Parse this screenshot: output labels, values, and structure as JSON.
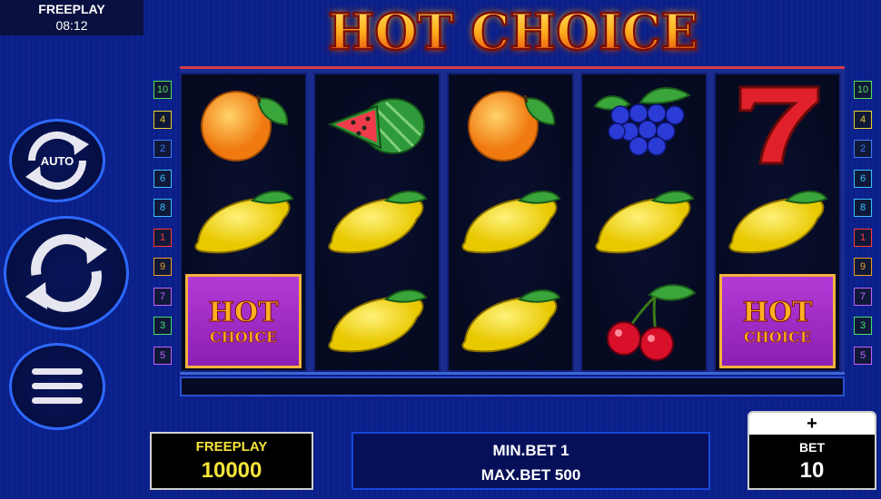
{
  "status": {
    "mode": "FREEPLAY",
    "time": "08:12"
  },
  "logo": {
    "text": "HOT CHOICE"
  },
  "left_lines": [
    "10",
    "4",
    "2",
    "6",
    "8",
    "1",
    "9",
    "7",
    "3",
    "5"
  ],
  "right_lines": [
    "10",
    "4",
    "2",
    "6",
    "8",
    "1",
    "9",
    "7",
    "3",
    "5"
  ],
  "line_colors": [
    "#55e055",
    "#e8d030",
    "#3f7bff",
    "#38c0ff",
    "#38c0ff",
    "#ff3a3a",
    "#e8a020",
    "#c060ff",
    "#40e070",
    "#c060ff"
  ],
  "reels": [
    [
      "orange",
      "lemon",
      "hot-choice"
    ],
    [
      "watermelon",
      "lemon",
      "lemon"
    ],
    [
      "orange",
      "lemon",
      "lemon"
    ],
    [
      "grapes",
      "lemon",
      "cherry"
    ],
    [
      "seven",
      "lemon",
      "hot-choice"
    ]
  ],
  "symbol_label": {
    "hot": "HOT",
    "choice": "CHOICE"
  },
  "buttons": {
    "auto_label": "AUTO"
  },
  "freeplay": {
    "label": "FREEPLAY",
    "value": "10000"
  },
  "limits": {
    "min": "MIN.BET 1",
    "max": "MAX.BET 500"
  },
  "bet": {
    "plus": "+",
    "label": "BET",
    "value": "10"
  }
}
